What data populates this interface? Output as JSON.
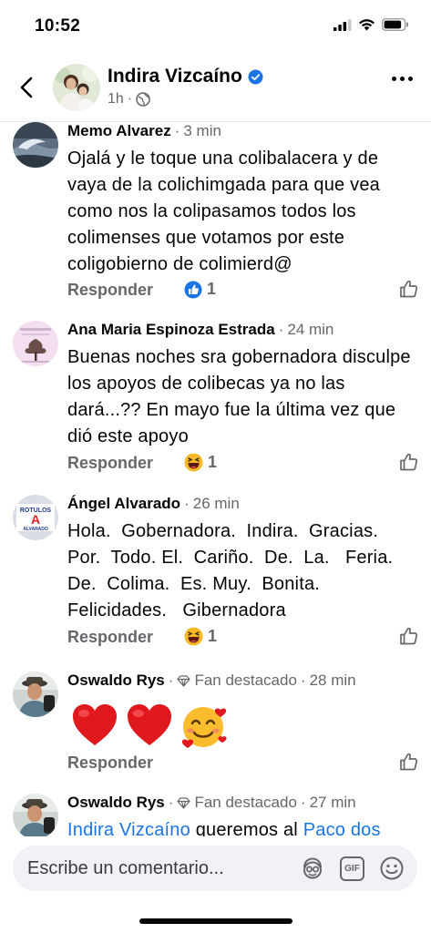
{
  "status": {
    "time": "10:52"
  },
  "header": {
    "name": "Indira Vizcaíno",
    "time": "1h",
    "dot": "·",
    "privacy_icon": "globe-icon",
    "verified_icon": "verified-badge-icon"
  },
  "comments": [
    {
      "name": "Memo Alvarez",
      "sep": "·",
      "time": "3 min",
      "text": "Ojalá y le toque una colibalacera y de vaya de la colichimgada para que vea como nos la colipasamos todos los colimenses que votamos por este coligobierno de colimierd@",
      "reply": "Responder",
      "reaction_icon": "like-reaction-icon",
      "reaction_count": "1"
    },
    {
      "name": "Ana Maria Espinoza Estrada",
      "sep": "·",
      "time": "24 min",
      "text": "Buenas noches sra gobernadora disculpe los apoyos de colibecas ya no las dará...?? En mayo fue la última vez que dió este apoyo",
      "reply": "Responder",
      "reaction_icon": "haha-reaction-icon",
      "reaction_count": "1"
    },
    {
      "name": "Ángel Alvarado",
      "sep": "·",
      "time": "26 min",
      "text": "Hola.  Gobernadora.  Indira.  Gracias.  Por.  Todo. El.  Cariño.  De.  La.   Feria. De.  Colima.  Es. Muy.  Bonita.    Felicidades.   Gibernadora",
      "reply": "Responder",
      "reaction_icon": "haha-reaction-icon",
      "reaction_count": "1",
      "avatar_text_top": "ROTULOS",
      "avatar_letter": "A",
      "avatar_text_bottom": "ALVARADO"
    },
    {
      "name": "Oswaldo Rys",
      "sep": "·",
      "badge": "Fan destacado",
      "time": "28 min",
      "emoji": "❤️ ❤️ 🥰",
      "reply": "Responder"
    },
    {
      "name": "Oswaldo Rys",
      "sep": "·",
      "badge": "Fan destacado",
      "time": "27 min",
      "mention": "Indira Vizcaíno",
      "text_mid": " queremos al ",
      "mention2": "Paco dos"
    }
  ],
  "composer": {
    "placeholder": "Escribe un comentario...",
    "gif_label": "GIF"
  },
  "colors": {
    "accent": "#1b74e4",
    "secondary_text": "#65676b",
    "composer_bg": "#f0f2f5"
  }
}
